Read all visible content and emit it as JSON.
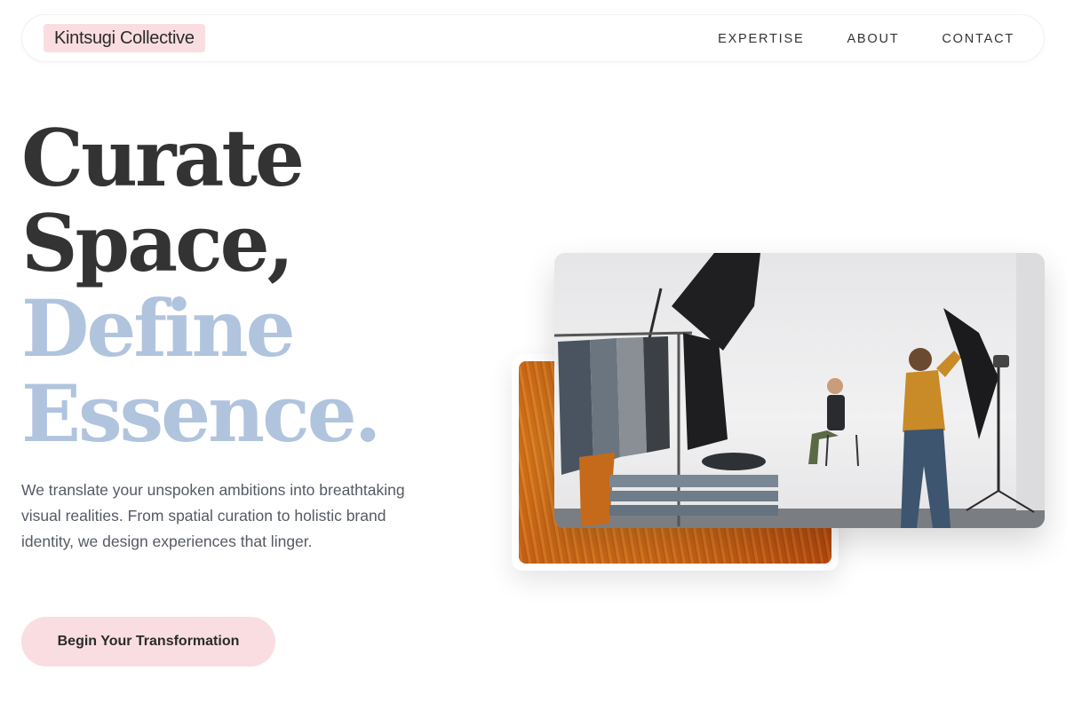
{
  "header": {
    "brand": "Kintsugi Collective",
    "nav": [
      {
        "label": "EXPERTISE"
      },
      {
        "label": "ABOUT"
      },
      {
        "label": "CONTACT"
      }
    ]
  },
  "hero": {
    "headline": {
      "line1": "Curate",
      "line2": "Space,",
      "line3": "Define",
      "line4": "Essence."
    },
    "description": "We translate your unspoken ambitions into breathtaking visual realities. From spatial curation to holistic brand identity, we design experiences that linger.",
    "cta_label": "Begin Your Transformation"
  },
  "colors": {
    "accent_pink": "#f9dde1",
    "accent_blue": "#b0c4de",
    "text_dark": "#333333"
  }
}
